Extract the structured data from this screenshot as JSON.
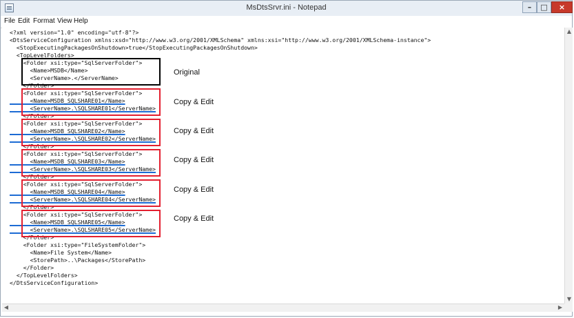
{
  "window": {
    "title": "MsDtsSrvr.ini - Notepad",
    "buttons": {
      "minimize": "–",
      "maximize": "□",
      "close": "×"
    }
  },
  "menu": [
    {
      "label": "File"
    },
    {
      "label": "Edit"
    },
    {
      "label": "Format"
    },
    {
      "label": "View"
    },
    {
      "label": "Help"
    }
  ],
  "editor": {
    "lines": [
      "<?xml version=\"1.0\" encoding=\"utf-8\"?>",
      "<DtsServiceConfiguration xmlns:xsd=\"http://www.w3.org/2001/XMLSchema\" xmlns:xsi=\"http://www.w3.org/2001/XMLSchema-instance\">",
      "  <StopExecutingPackagesOnShutdown>true</StopExecutingPackagesOnShutdown>",
      "  <TopLevelFolders>",
      "    <Folder xsi:type=\"SqlServerFolder\">",
      "      <Name>MSDB</Name>",
      "      <ServerName>.</ServerName>",
      "    </Folder>",
      "    <Folder xsi:type=\"SqlServerFolder\">",
      "      <Name>MSDB_SQLSHARE01</Name>",
      "      <ServerName>.\\SQLSHARE01</ServerName>",
      "    </Folder>",
      "    <Folder xsi:type=\"SqlServerFolder\">",
      "      <Name>MSDB_SQLSHARE02</Name>",
      "      <ServerName>.\\SQLSHARE02</ServerName>",
      "    </Folder>",
      "    <Folder xsi:type=\"SqlServerFolder\">",
      "      <Name>MSDB_SQLSHARE03</Name>",
      "      <ServerName>.\\SQLSHARE03</ServerName>",
      "    </Folder>",
      "    <Folder xsi:type=\"SqlServerFolder\">",
      "      <Name>MSDB_SQLSHARE04</Name>",
      "      <ServerName>.\\SQLSHARE04</ServerName>",
      "    </Folder>",
      "    <Folder xsi:type=\"SqlServerFolder\">",
      "      <Name>MSDB_SQLSHARE05</Name>",
      "      <ServerName>.\\SQLSHARE05</ServerName>",
      "    </Folder>",
      "    <Folder xsi:type=\"FileSystemFolder\">",
      "      <Name>File System</Name>",
      "      <StorePath>..\\Packages</StorePath>",
      "    </Folder>",
      "  </TopLevelFolders>",
      "</DtsServiceConfiguration>"
    ]
  },
  "annotations": [
    {
      "text": "Original",
      "color": "#000000"
    },
    {
      "text": "Copy & Edit",
      "color": "#e31e2e"
    },
    {
      "text": "Copy & Edit",
      "color": "#e31e2e"
    },
    {
      "text": "Copy & Edit",
      "color": "#e31e2e"
    },
    {
      "text": "Copy & Edit",
      "color": "#e31e2e"
    },
    {
      "text": "Copy & Edit",
      "color": "#e31e2e"
    }
  ],
  "underline_color": "#1c6bd4"
}
